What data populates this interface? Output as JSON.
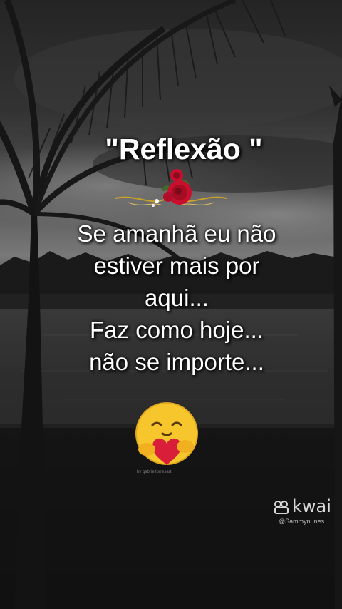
{
  "post": {
    "title": "\"Reflexão \"",
    "message_lines": [
      "Se amanhã eu não",
      "estiver mais por",
      "aqui...",
      "Faz como hoje...",
      "não se importe..."
    ],
    "title_decoration_icon": "red-roses-ornament",
    "emoji_icon": "hugging-heart-face",
    "credit": "by gabrieltorresart"
  },
  "watermark": {
    "brand": "kwai",
    "handle": "@Sammynunes",
    "icon": "kwai-camera-icon"
  },
  "colors": {
    "text": "#ffffff",
    "rose_red": "#c8102e",
    "emoji_yellow": "#f7c62c",
    "watermark": "#d8d8d8"
  }
}
